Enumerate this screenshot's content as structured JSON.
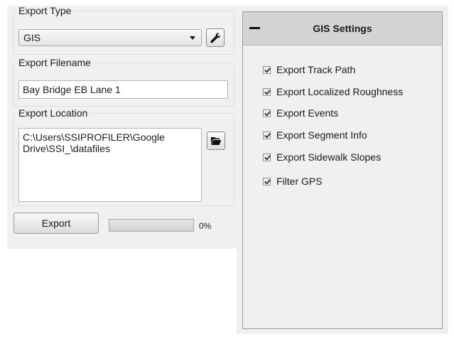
{
  "export_type": {
    "legend": "Export Type",
    "selected": "GIS",
    "settings_icon": "wrench-icon"
  },
  "export_filename": {
    "legend": "Export Filename",
    "value": "Bay Bridge EB Lane 1"
  },
  "export_location": {
    "legend": "Export Location",
    "value": "C:\\Users\\SSIPROFILER\\Google Drive\\SSI_\\datafiles",
    "browse_icon": "folder-open-icon"
  },
  "actions": {
    "export_label": "Export",
    "progress_fraction": 0,
    "progress_text": "0%"
  },
  "gis_settings": {
    "title": "GIS Settings",
    "collapse_icon": "minus-icon",
    "options": [
      {
        "label": "Export Track Path",
        "checked": true
      },
      {
        "label": "Export Localized Roughness",
        "checked": true
      },
      {
        "label": "Export Events",
        "checked": true
      },
      {
        "label": "Export Segment Info",
        "checked": true
      },
      {
        "label": "Export Sidewalk Slopes",
        "checked": true
      },
      {
        "label": "Filter GPS",
        "checked": true
      }
    ]
  }
}
